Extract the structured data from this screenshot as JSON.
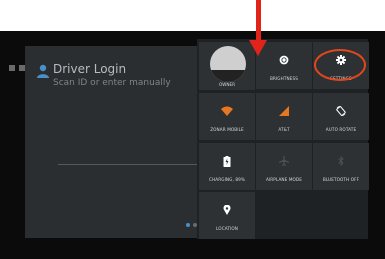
{
  "login": {
    "title": "Driver Login",
    "subtitle": "Scan ID or enter manually"
  },
  "quick_settings": {
    "owner": "OWNER",
    "brightness": "BRIGHTNESS",
    "settings": "SETTINGS",
    "wifi": "ZONAR MOBILE",
    "cellular": "AT&T",
    "rotate": "AUTO ROTATE",
    "battery": "CHARGING, 89%",
    "airplane": "AIRPLANE MODE",
    "bluetooth": "BLUETOOTH OFF",
    "location": "LOCATION"
  },
  "icons": {
    "brightness": "brightness-icon",
    "settings": "gear-icon",
    "wifi": "wifi-icon",
    "cellular": "signal-icon",
    "rotate": "rotate-icon",
    "battery": "battery-icon",
    "airplane": "airplane-icon",
    "bluetooth": "bluetooth-icon",
    "location": "location-pin-icon"
  },
  "colors": {
    "annotation": "#e2231a",
    "wifi_accent": "#e87722",
    "accent_blue": "#4a90c8"
  }
}
